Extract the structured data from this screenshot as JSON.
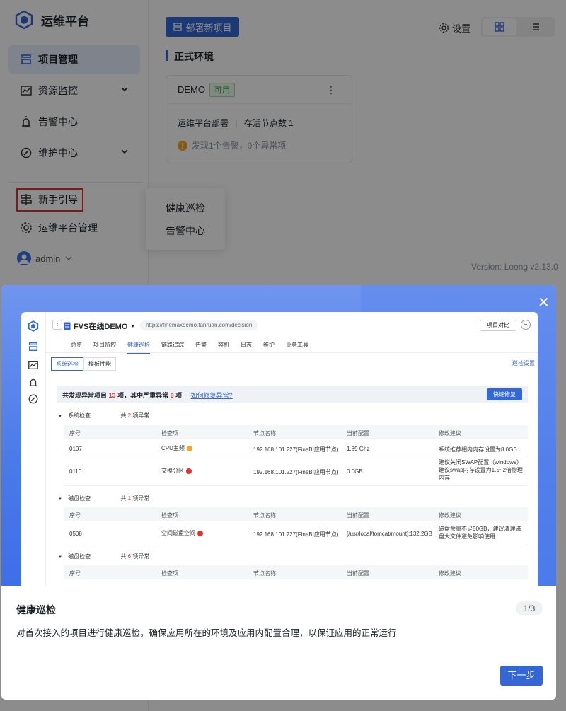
{
  "sidebar": {
    "logo_title": "运维平台",
    "items": [
      {
        "label": "项目管理"
      },
      {
        "label": "资源监控"
      },
      {
        "label": "告警中心"
      },
      {
        "label": "维护中心"
      }
    ],
    "bottom_items": [
      {
        "label": "新手引导"
      },
      {
        "label": "运维平台管理"
      }
    ],
    "user": "admin"
  },
  "main": {
    "deploy_button": "部署新项目",
    "settings_label": "设置",
    "section_title": "正式环境",
    "card": {
      "name": "DEMO",
      "badge": "可用",
      "desc": "运维平台部署",
      "nodes": "存活节点数 1",
      "alert": "发现1个告警，0个异常项"
    },
    "version": "Version: Loong v2.13.0"
  },
  "popover": {
    "items": [
      "健康巡检",
      "告警中心"
    ]
  },
  "modal": {
    "title": "健康巡检",
    "page": "1/3",
    "description": "对首次接入的项目进行健康巡检，确保应用所在的环境及应用内配置合理，以保证应用的正常运行",
    "next_button": "下一步",
    "screenshot": {
      "project": "FVS在线DEMO",
      "url": "https://finemaxdemo.fanruan.com/decision",
      "compare": "项目对比",
      "tabs": [
        "总览",
        "项目监控",
        "健康巡检",
        "链路追踪",
        "告警",
        "容机",
        "日志",
        "维护",
        "业务工具"
      ],
      "subtabs": [
        "系统巡检",
        "模板性能"
      ],
      "setting": "巡检设置",
      "alert_prefix": "共发现异常项目",
      "alert_count": "13",
      "alert_mid": "项，其中严重异常",
      "alert_severe": "6",
      "alert_suffix": "项",
      "alert_link": "如何修复异常?",
      "fix_button": "快速修复",
      "headers": [
        "序号",
        "检查项",
        "节点名称",
        "当前配置",
        "修改建议"
      ],
      "groups": [
        {
          "name": "系统检查",
          "summary_pre": "共",
          "count": "2",
          "summary_post": "项异常"
        },
        {
          "name": "磁盘检查",
          "summary_pre": "共",
          "count": "1",
          "summary_post": "项异常"
        },
        {
          "name": "磁盘检查",
          "summary_pre": "共",
          "count": "6",
          "summary_post": "项异常"
        }
      ],
      "rows": [
        {
          "id": "0107",
          "item": "CPU主频",
          "node": "192.168.101.227(FineBI应用节点)",
          "config": "1.89 Ghz",
          "advice": "系统推荐相内内存设置为8.0GB"
        },
        {
          "id": "0110",
          "item": "交换分区",
          "node": "192.168.101.227(FineBI应用节点)",
          "config": "0.0GB",
          "advice": "建议关闭SWAP配置（windows）建议swap内存设置为1.5~2倍物理内存"
        },
        {
          "id": "0508",
          "item": "空间磁盘空间",
          "node": "192.168.101.227(FineBI应用节点)",
          "config": "[/usr/local/tomcat/mount]:132.2GB",
          "advice": "磁盘余量不足50GB，建议清理磁盘大文件避免影响使用"
        }
      ]
    }
  },
  "colors": {
    "primary": "#3366d6",
    "danger": "#e5302e",
    "warning": "#f5a524",
    "success": "#2aa444"
  }
}
